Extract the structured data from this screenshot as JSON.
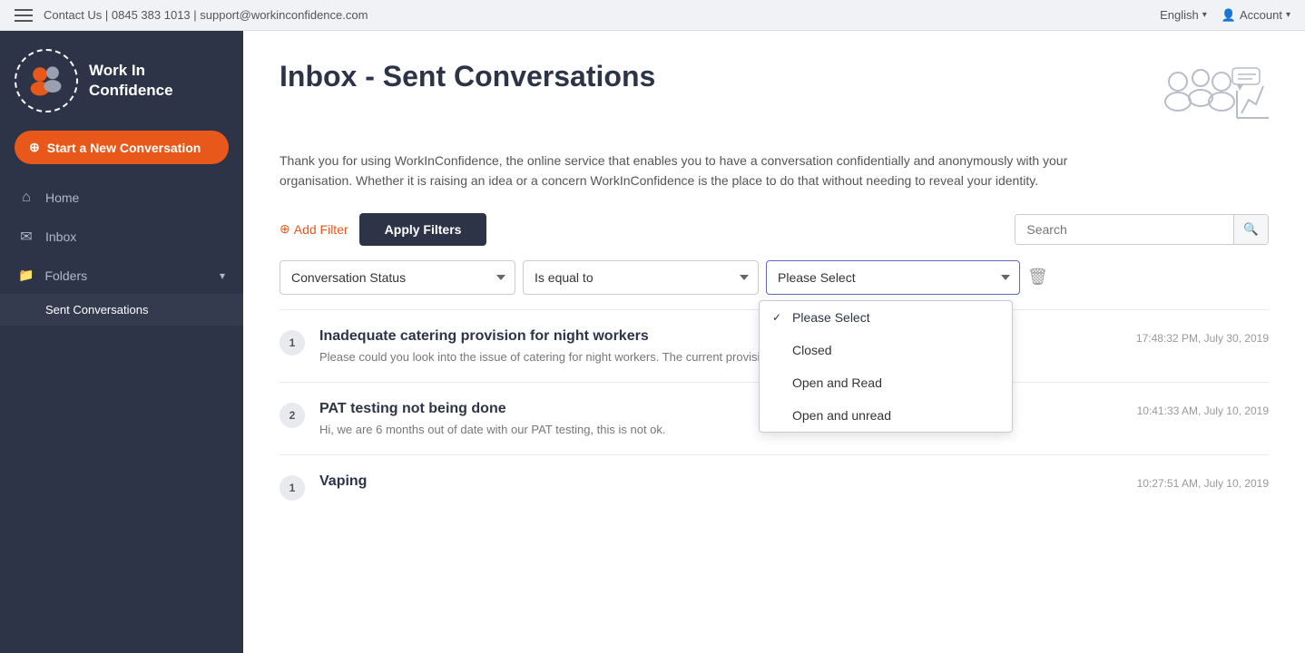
{
  "topbar": {
    "contact": "Contact Us | 0845 383 1013 | support@workinconfidence.com",
    "language": "English",
    "account": "Account"
  },
  "sidebar": {
    "logo_text": "Work In\nConfidence",
    "new_conversation_label": "Start a New Conversation",
    "nav_items": [
      {
        "id": "home",
        "label": "Home",
        "icon": "⌂"
      },
      {
        "id": "inbox",
        "label": "Inbox",
        "icon": "✉"
      },
      {
        "id": "folders",
        "label": "Folders",
        "icon": "📁"
      }
    ],
    "sub_nav_items": [
      {
        "id": "sent-conversations",
        "label": "Sent Conversations"
      }
    ]
  },
  "main": {
    "title": "Inbox - Sent Conversations",
    "description": "Thank you for using WorkInConfidence, the online service that enables you to have a conversation confidentially and anonymously with your organisation. Whether it is raising an idea or a concern WorkInConfidence is the place to do that without needing to reveal your identity.",
    "add_filter_label": "Add Filter",
    "apply_filters_label": "Apply Filters",
    "search_placeholder": "Search",
    "filter": {
      "field_label": "Conversation Status",
      "operator_label": "Is equal to",
      "value_label": "Please Select"
    },
    "dropdown_options": [
      {
        "id": "please-select",
        "label": "Please Select",
        "selected": true
      },
      {
        "id": "closed",
        "label": "Closed",
        "selected": false
      },
      {
        "id": "open-read",
        "label": "Open and Read",
        "selected": false
      },
      {
        "id": "open-unread",
        "label": "Open and unread",
        "selected": false
      }
    ],
    "conversations": [
      {
        "number": "1",
        "title": "Inadequate catering provision for night workers",
        "preview": "Please could you look into the issue of catering for night workers. The current provision",
        "time": "17:48:32 PM, July 30, 2019"
      },
      {
        "number": "2",
        "title": "PAT testing not being done",
        "preview": "Hi, we are 6 months out of date with our PAT testing, this is not ok.",
        "time": "10:41:33 AM, July 10, 2019"
      },
      {
        "number": "1",
        "title": "Vaping",
        "preview": "",
        "time": "10:27:51 AM, July 10, 2019"
      }
    ]
  }
}
